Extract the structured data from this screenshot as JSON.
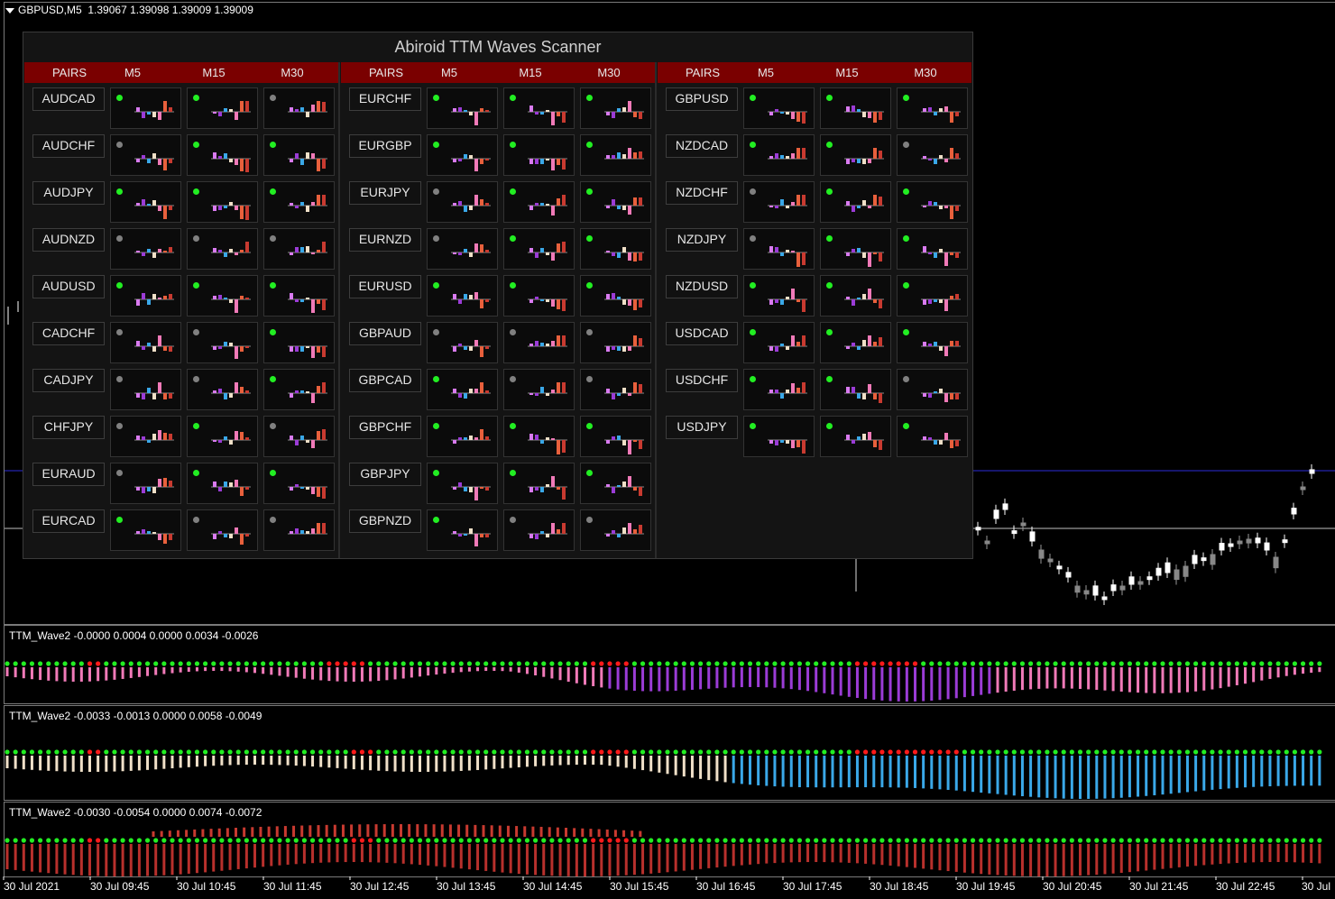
{
  "header": {
    "symbol": "GBPUSD,M5",
    "prices": "1.39067 1.39098 1.39009 1.39009"
  },
  "scanner": {
    "title": "Abiroid TTM Waves Scanner",
    "col_headers": [
      "PAIRS",
      "M5",
      "M15",
      "M30"
    ],
    "colors": {
      "header_bg": "#7a0000",
      "green": "#22ee22",
      "gray": "#808080"
    },
    "sections": [
      {
        "pairs": [
          {
            "name": "AUDCAD",
            "dots": [
              "green",
              "green",
              "gray"
            ]
          },
          {
            "name": "AUDCHF",
            "dots": [
              "gray",
              "green",
              "green"
            ]
          },
          {
            "name": "AUDJPY",
            "dots": [
              "green",
              "green",
              "green"
            ]
          },
          {
            "name": "AUDNZD",
            "dots": [
              "gray",
              "gray",
              "gray"
            ]
          },
          {
            "name": "AUDUSD",
            "dots": [
              "green",
              "green",
              "green"
            ]
          },
          {
            "name": "CADCHF",
            "dots": [
              "gray",
              "gray",
              "green"
            ]
          },
          {
            "name": "CADJPY",
            "dots": [
              "gray",
              "gray",
              "green"
            ]
          },
          {
            "name": "CHFJPY",
            "dots": [
              "gray",
              "green",
              "gray"
            ]
          },
          {
            "name": "EURAUD",
            "dots": [
              "gray",
              "green",
              "green"
            ]
          },
          {
            "name": "EURCAD",
            "dots": [
              "green",
              "gray",
              "gray"
            ]
          }
        ]
      },
      {
        "pairs": [
          {
            "name": "EURCHF",
            "dots": [
              "green",
              "green",
              "green"
            ]
          },
          {
            "name": "EURGBP",
            "dots": [
              "green",
              "green",
              "green"
            ]
          },
          {
            "name": "EURJPY",
            "dots": [
              "gray",
              "green",
              "green"
            ]
          },
          {
            "name": "EURNZD",
            "dots": [
              "gray",
              "green",
              "green"
            ]
          },
          {
            "name": "EURUSD",
            "dots": [
              "green",
              "green",
              "green"
            ]
          },
          {
            "name": "GBPAUD",
            "dots": [
              "gray",
              "gray",
              "gray"
            ]
          },
          {
            "name": "GBPCAD",
            "dots": [
              "green",
              "gray",
              "gray"
            ]
          },
          {
            "name": "GBPCHF",
            "dots": [
              "green",
              "green",
              "green"
            ]
          },
          {
            "name": "GBPJPY",
            "dots": [
              "green",
              "green",
              "green"
            ]
          },
          {
            "name": "GBPNZD",
            "dots": [
              "green",
              "gray",
              "gray"
            ]
          }
        ]
      },
      {
        "pairs": [
          {
            "name": "GBPUSD",
            "dots": [
              "green",
              "green",
              "green"
            ]
          },
          {
            "name": "NZDCAD",
            "dots": [
              "green",
              "green",
              "gray"
            ]
          },
          {
            "name": "NZDCHF",
            "dots": [
              "gray",
              "green",
              "green"
            ]
          },
          {
            "name": "NZDJPY",
            "dots": [
              "gray",
              "green",
              "green"
            ]
          },
          {
            "name": "NZDUSD",
            "dots": [
              "green",
              "green",
              "green"
            ]
          },
          {
            "name": "USDCAD",
            "dots": [
              "green",
              "green",
              "green"
            ]
          },
          {
            "name": "USDCHF",
            "dots": [
              "green",
              "green",
              "gray"
            ]
          },
          {
            "name": "USDJPY",
            "dots": [
              "green",
              "green",
              "green"
            ]
          }
        ]
      }
    ]
  },
  "indicators": [
    {
      "label": "TTM_Wave2 -0.0000 0.0004 0.0000 0.0034 -0.0026"
    },
    {
      "label": "TTM_Wave2 -0.0033 -0.0013 0.0000 0.0058 -0.0049"
    },
    {
      "label": "TTM_Wave2 -0.0030 -0.0054 0.0000 0.0074 -0.0072"
    }
  ],
  "time_axis": [
    "30 Jul 2021",
    "30 Jul 09:45",
    "30 Jul 10:45",
    "30 Jul 11:45",
    "30 Jul 12:45",
    "30 Jul 13:45",
    "30 Jul 14:45",
    "30 Jul 15:45",
    "30 Jul 16:45",
    "30 Jul 17:45",
    "30 Jul 18:45",
    "30 Jul 19:45",
    "30 Jul 20:45",
    "30 Jul 21:45",
    "30 Jul 22:45",
    "30 Jul"
  ]
}
